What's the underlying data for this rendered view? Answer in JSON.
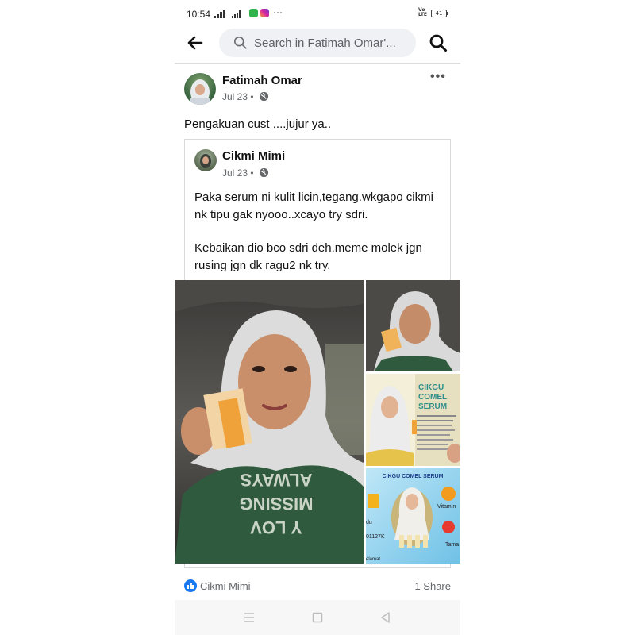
{
  "status_bar": {
    "time": "10:54",
    "battery": "41"
  },
  "header": {
    "search_placeholder": "Search in Fatimah Omar'..."
  },
  "post": {
    "author": "Fatimah Omar",
    "date": "Jul 23",
    "separator": "•",
    "caption": "Pengakuan cust ....jujur ya..",
    "shared": {
      "author": "Cikmi Mimi",
      "date": "Jul 23",
      "separator": "•",
      "paragraphs": [
        "Paka serum ni kulit licin,tegang.wkgapo cikmi nk tipu gak nyooo..xcayo try sdri.",
        "Kebaikan dio bco sdri deh.meme molek jgn rusing jgn dk ragu2 nk try."
      ]
    },
    "photos": {
      "main_shirt_text": [
        "ALWAYS",
        "MISSING",
        "Y LOV"
      ],
      "cikgu_banner": [
        "CIKGU",
        "COMEL",
        "SERUM"
      ],
      "cikgu_banner2_title": "CIKGU COMEL SERUM",
      "vitamin_label": "Vitamin",
      "tomato_label": "Tama",
      "side_text": [
        "du",
        "01127K"
      ],
      "bottom_text": "elamat"
    }
  },
  "footer": {
    "reaction_name": "Cikmi Mimi",
    "share_count": "1 Share"
  },
  "colors": {
    "accent_blue": "#1877f2",
    "meta_gray": "#65676b",
    "search_bg": "#eff1f4"
  }
}
